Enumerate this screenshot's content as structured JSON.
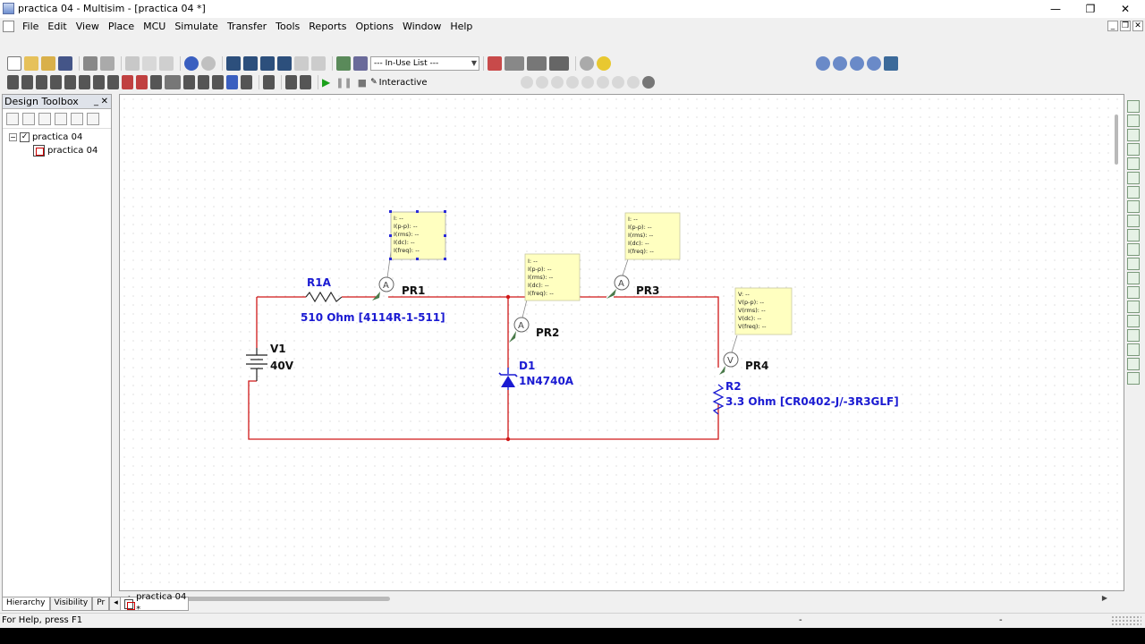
{
  "window": {
    "title": "practica 04 - Multisim - [practica 04 *]",
    "minimize": "—",
    "restore": "❐",
    "close": "✕"
  },
  "menu": [
    "File",
    "Edit",
    "View",
    "Place",
    "MCU",
    "Simulate",
    "Transfer",
    "Tools",
    "Reports",
    "Options",
    "Window",
    "Help"
  ],
  "toolbar": {
    "in_use_list": "--- In-Use List ---",
    "interactive": "Interactive"
  },
  "toolbox": {
    "title": "Design Toolbox",
    "pin": "_",
    "close": "✕",
    "project": "practica 04",
    "sheet": "practica 04",
    "tabs": [
      "Hierarchy",
      "Visibility",
      "Pr"
    ]
  },
  "doc_tab": "practica 04 *",
  "status": {
    "help": "For Help, press F1",
    "s2": "-",
    "s3": "-"
  },
  "schematic": {
    "r1a": {
      "ref": "R1A",
      "value": "510 Ohm  [4114R-1-511]"
    },
    "v1": {
      "ref": "V1",
      "value": "40V"
    },
    "d1": {
      "ref": "D1",
      "value": "1N4740A"
    },
    "r2": {
      "ref": "R2",
      "value": "3.3 Ohm  [CR0402-J/-3R3GLF]"
    },
    "probes": {
      "pr1": {
        "label": "PR1",
        "symbol": "A"
      },
      "pr2": {
        "label": "PR2",
        "symbol": "A"
      },
      "pr3": {
        "label": "PR3",
        "symbol": "A"
      },
      "pr4": {
        "label": "PR4",
        "symbol": "V"
      }
    },
    "current_note": [
      "I: --",
      "I(p-p): --",
      "I(rms): --",
      "I(dc): --",
      "I(freq): --"
    ],
    "voltage_note": [
      "V: --",
      "V(p-p): --",
      "V(rms): --",
      "V(dc): --",
      "V(freq): --"
    ]
  },
  "colors": {
    "wire": "#d01818",
    "component": "#1a1ad2",
    "note_bg": "#ffffc0"
  }
}
